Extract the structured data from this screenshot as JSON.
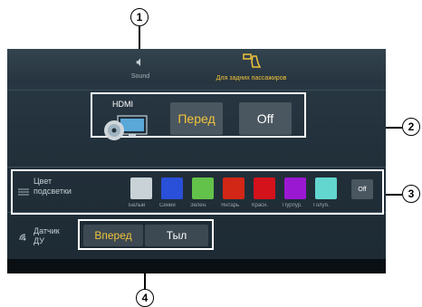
{
  "callouts": [
    "1",
    "2",
    "3",
    "4"
  ],
  "tabs": [
    {
      "label": "Sound",
      "icon": "speaker-icon",
      "active": false
    },
    {
      "label": "Для задних пассажиров",
      "icon": "rear-seat-icon",
      "active": true
    }
  ],
  "source": {
    "hdmi_label": "HDMI",
    "front_label": "Перед",
    "off_label": "Off"
  },
  "backlight": {
    "label_line1": "Цвет",
    "label_line2": "подсветки",
    "off_label": "Off",
    "colors": [
      {
        "name": "Белый",
        "hex": "#c9d2d6"
      },
      {
        "name": "Синий",
        "hex": "#2a4fd8"
      },
      {
        "name": "Зелен.",
        "hex": "#63c24a"
      },
      {
        "name": "Янтарь",
        "hex": "#d22616"
      },
      {
        "name": "Красн.",
        "hex": "#d3121c"
      },
      {
        "name": "Пурпур.",
        "hex": "#9b18d2"
      },
      {
        "name": "Голуб.",
        "hex": "#63d6cf"
      }
    ]
  },
  "remote_sensor": {
    "label_line1": "Датчик",
    "label_line2": "ДУ",
    "forward_label": "Вперед",
    "rear_label": "Тыл"
  },
  "accent_color": "#f0c43a"
}
